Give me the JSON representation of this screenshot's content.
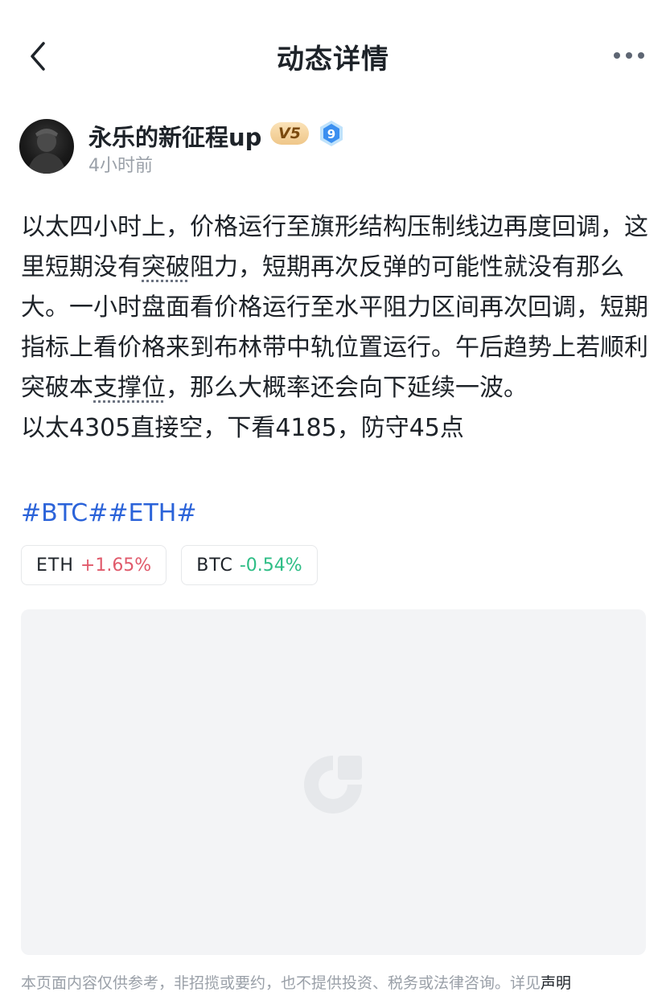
{
  "nav": {
    "title": "动态详情",
    "back_icon": "chevron-left-icon",
    "more_icon": "more-dots-icon"
  },
  "author": {
    "name": "永乐的新征程up",
    "vip_badge": "V5",
    "level_badge": "9",
    "time": "4小时前"
  },
  "post": {
    "paragraph": [
      "以太四小时上，价格运行至旗形结构压制线边再度回调，这里短期没有",
      "突破",
      "阻力，短期再次反弹的可能性就没有那么大。一小时盘面看价格运行至水平阻力区间再次回调，短期指标上看价格来到布林带中轨位置运行。午后趋势上若顺利突破本",
      "支撑位",
      "，那么大概率还会向下延续一波。"
    ],
    "trade_line": "以太4305直接空，下看4185，防守45点",
    "hashtags": [
      "#BTC#",
      "#ETH#"
    ]
  },
  "coins": [
    {
      "symbol": "ETH",
      "change": "+1.65%",
      "direction": "up"
    },
    {
      "symbol": "BTC",
      "change": "-0.54%",
      "direction": "down"
    }
  ],
  "colors": {
    "up": "#e05a6b",
    "down": "#2dbd85",
    "hashtag": "#2b63d9",
    "image_placeholder": "#f3f4f6"
  },
  "footer": {
    "disclaimer": "本页面内容仅供参考，非招揽或要约，也不提供投资、税务或法律咨询。详见",
    "link": "声明"
  }
}
